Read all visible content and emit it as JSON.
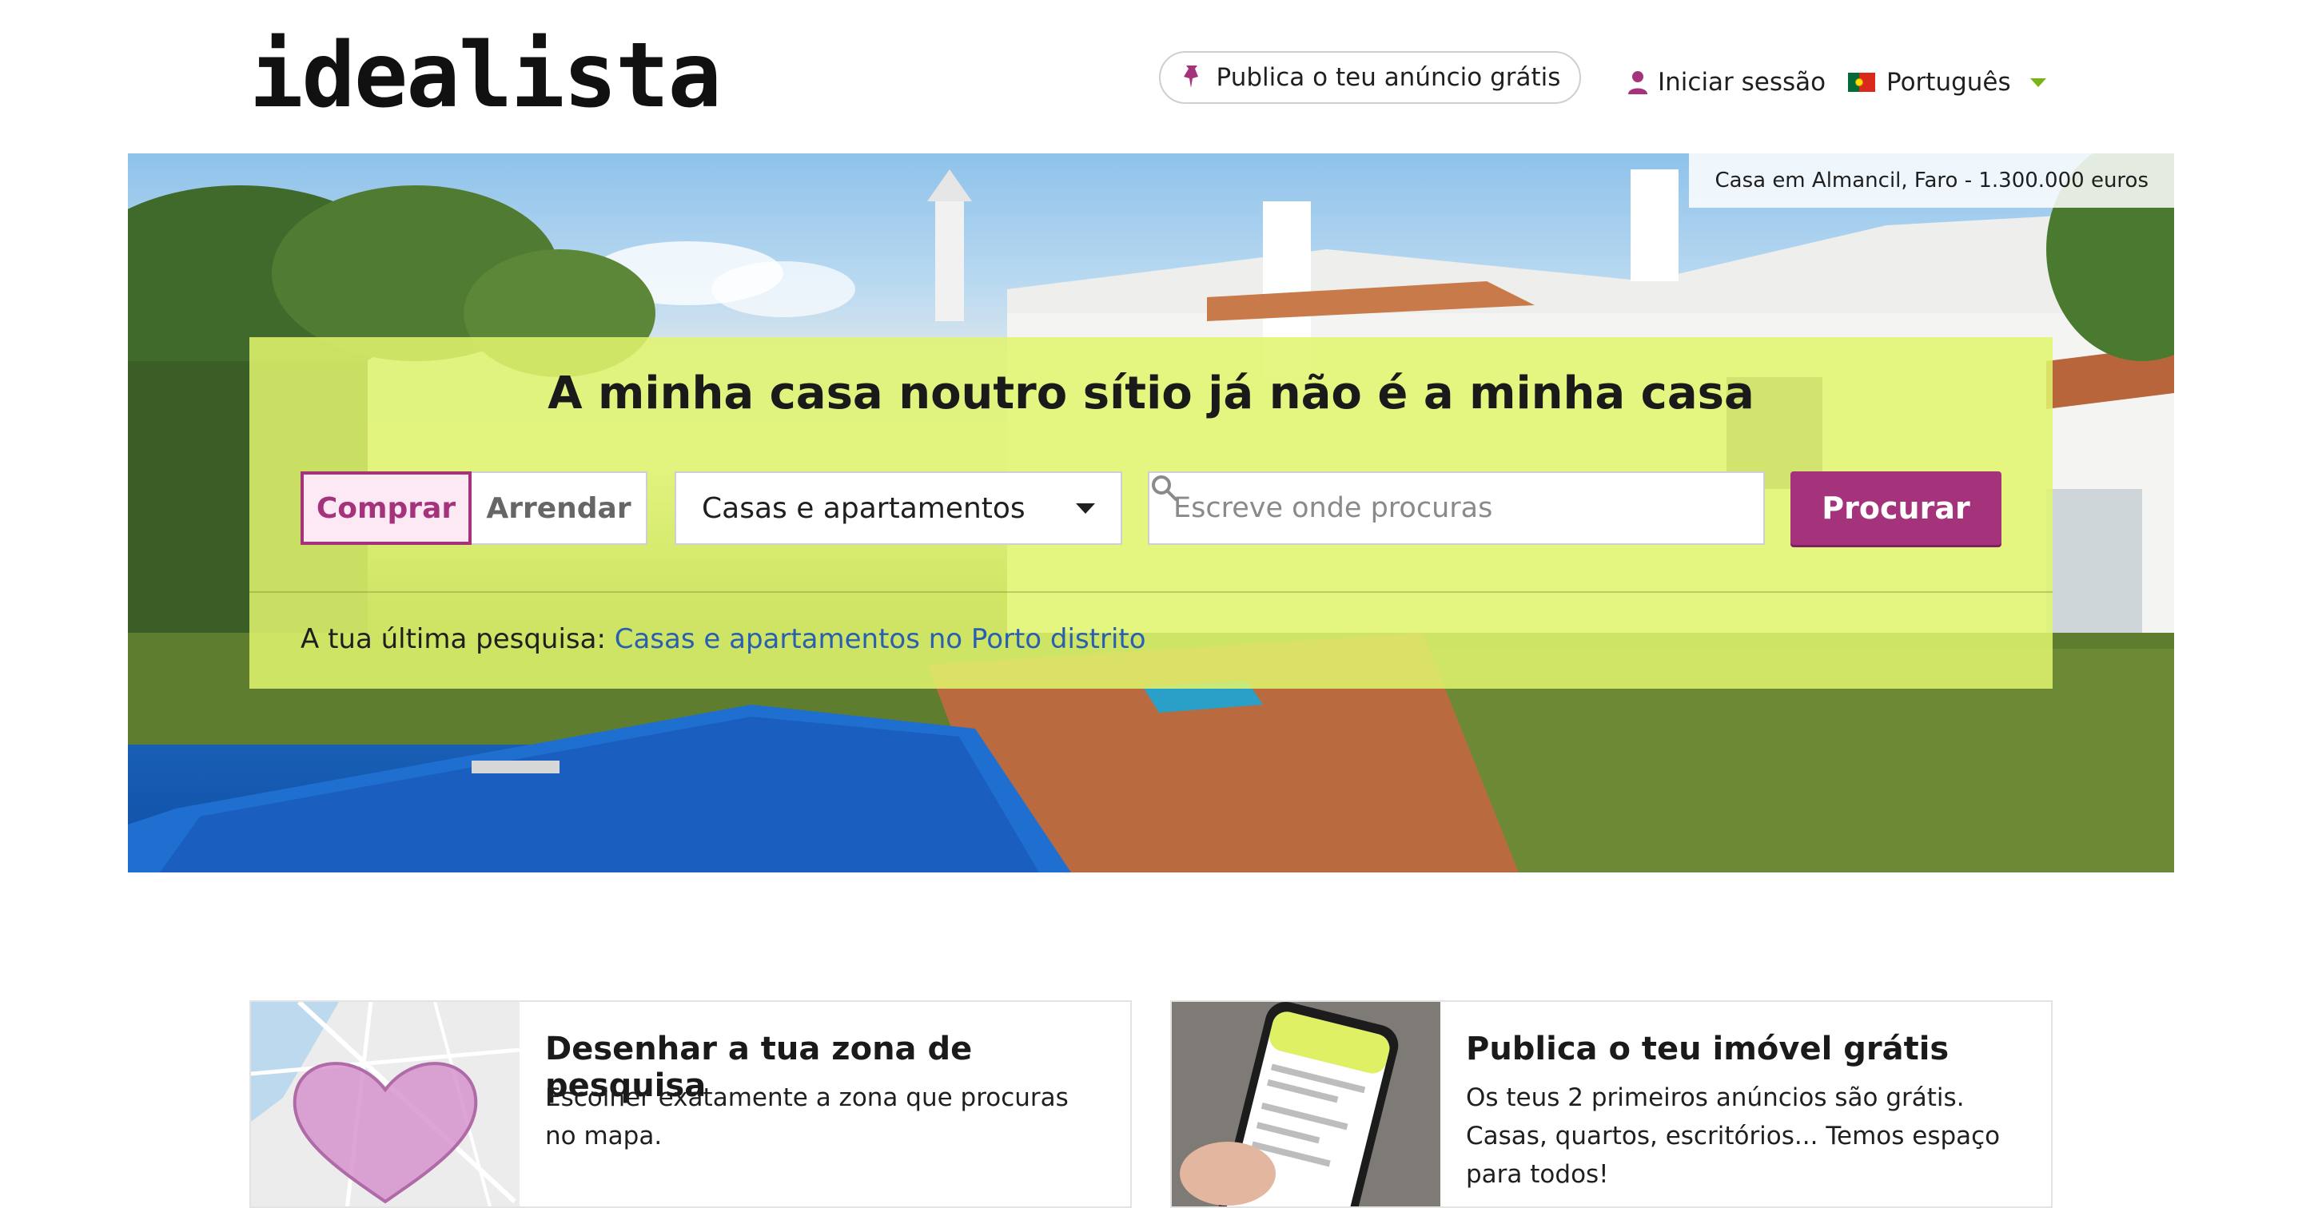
{
  "header": {
    "logo": "idealista",
    "publish_label": "Publica o teu anúncio grátis",
    "login_label": "Iniciar sessão",
    "language_label": "Português"
  },
  "hero": {
    "caption": "Casa em Almancil, Faro - 1.300.000 euros",
    "headline": "A minha casa noutro sítio já não é a minha casa",
    "operation": {
      "buy": "Comprar",
      "rent": "Arrendar"
    },
    "property_type": "Casas e apartamentos",
    "search": {
      "placeholder": "Escreve onde procuras"
    },
    "search_button": "Procurar",
    "last_search_label": "A tua última pesquisa:",
    "last_search_link": "Casas e apartamentos no Porto distrito"
  },
  "cards": [
    {
      "title": "Desenhar a tua zona de pesquisa",
      "description": "Escolher exatamente a zona que procuras no mapa."
    },
    {
      "title": "Publica o teu imóvel grátis",
      "description": "Os teus 2 primeiros anúncios são grátis. Casas, quartos, escritórios... Temos espaço para todos!"
    }
  ],
  "colors": {
    "brand": "#a5337c",
    "panel": "#e1f56e",
    "link": "#2a5fb0",
    "language_caret": "#7ab317"
  },
  "icons": {
    "publish": "pin-icon",
    "login": "user-icon",
    "language": "portugal-flag-icon",
    "search": "search-icon"
  }
}
